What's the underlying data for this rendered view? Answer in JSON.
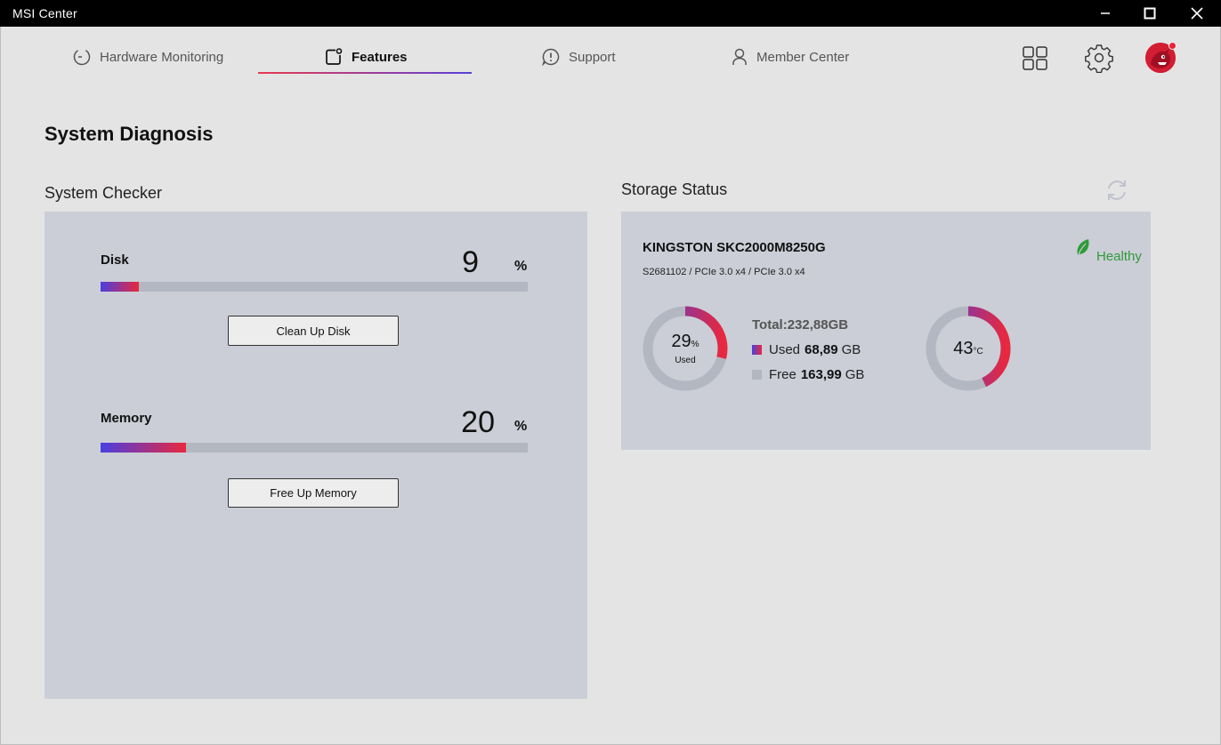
{
  "window": {
    "title": "MSI Center"
  },
  "nav": {
    "tabs": [
      {
        "label": "Hardware Monitoring",
        "icon": "monitor-gauge-icon"
      },
      {
        "label": "Features",
        "icon": "features-square-icon",
        "active": true
      },
      {
        "label": "Support",
        "icon": "support-alert-icon"
      },
      {
        "label": "Member Center",
        "icon": "member-person-icon"
      }
    ],
    "accent_gradient": [
      "#e83a4f",
      "#5a3fd8"
    ]
  },
  "page": {
    "title": "System Diagnosis"
  },
  "system_checker": {
    "title": "System Checker",
    "disk": {
      "label": "Disk",
      "value": "9",
      "unit": "%",
      "percent": 9,
      "button": "Clean Up Disk"
    },
    "memory": {
      "label": "Memory",
      "value": "20",
      "unit": "%",
      "percent": 20,
      "button": "Free Up Memory"
    }
  },
  "storage": {
    "title": "Storage Status",
    "drive_name": "KINGSTON SKC2000M8250G",
    "drive_details": "S2681102 / PCIe 3.0 x4 / PCIe 3.0 x4",
    "health": "Healthy",
    "health_color": "#2f9a3a",
    "usage": {
      "percent": 29,
      "value": "29",
      "unit": "%",
      "label": "Used"
    },
    "total": "Total:232,88GB",
    "used": {
      "label": "Used",
      "value": "68,89",
      "unit": "GB"
    },
    "free": {
      "label": "Free",
      "value": "163,99",
      "unit": "GB"
    },
    "temperature": {
      "value": "43",
      "unit": "°C",
      "fraction": 0.43
    }
  }
}
